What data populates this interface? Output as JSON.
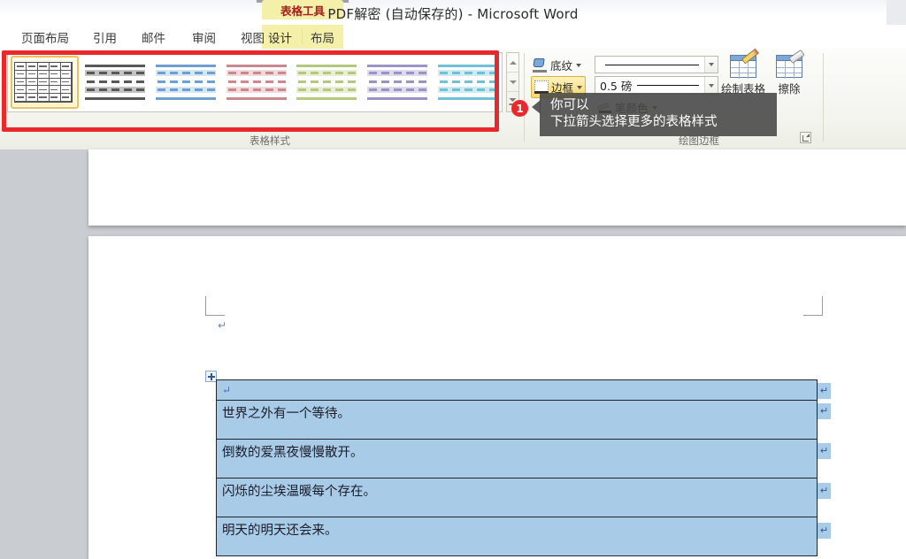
{
  "window": {
    "title": "PDF解密 (自动保存的)  -  Microsoft Word",
    "contextual_tab_group": "表格工具"
  },
  "ribbon": {
    "tabs": [
      {
        "label": "页面布局",
        "active": false
      },
      {
        "label": "引用",
        "active": false
      },
      {
        "label": "邮件",
        "active": false
      },
      {
        "label": "审阅",
        "active": false
      },
      {
        "label": "视图",
        "active": false
      },
      {
        "label": "设计",
        "active": true
      },
      {
        "label": "布局",
        "active": false
      }
    ],
    "groups": [
      {
        "label": "表格样式"
      },
      {
        "label": "绘图边框"
      }
    ],
    "table_styles": [
      {
        "name": "table-grid",
        "accent": "#4a4a4a",
        "selected": true,
        "kind": "grid"
      },
      {
        "name": "table-list-dark",
        "accent": "#58585a",
        "band": "#bdbdbd",
        "selected": false,
        "kind": "striped"
      },
      {
        "name": "table-list-blue",
        "accent": "#6f9fd0",
        "band": "#c6dcf0",
        "selected": false,
        "kind": "striped"
      },
      {
        "name": "table-list-red",
        "accent": "#c88a8d",
        "band": "#f0d3d5",
        "selected": false,
        "kind": "striped"
      },
      {
        "name": "table-list-green",
        "accent": "#b4c97e",
        "band": "#e2ebc8",
        "selected": false,
        "kind": "striped"
      },
      {
        "name": "table-list-purple",
        "accent": "#9a93c6",
        "band": "#d6d3ea",
        "selected": false,
        "kind": "striped"
      },
      {
        "name": "table-list-cyan",
        "accent": "#6fc0d8",
        "band": "#bfe4ee",
        "selected": false,
        "kind": "striped"
      }
    ],
    "gallery_scroll": {
      "up": "scroll-up",
      "down": "scroll-down",
      "more": "more-styles"
    },
    "shading_label": "底纹",
    "borders_label": "边框",
    "line_style_value": "",
    "line_weight_value": "0.5 磅",
    "pen_color_label": "笔颜色",
    "draw_table_label": "绘制表格",
    "eraser_label": "擦除"
  },
  "annotation": {
    "badge_number": "1",
    "callout_line1": "你可以",
    "callout_line2": "下拉箭头选择更多的表格样式",
    "highlight_color": "#e8282a"
  },
  "document": {
    "table_rows": [
      "",
      "世界之外有一个等待。",
      "倒数的爱黑夜慢慢散开。",
      "闪烁的尘埃温暖每个存在。",
      "明天的明天还会来。"
    ],
    "paragraph_mark": "↵",
    "cell_mark": "↵",
    "row_end_mark": "↵"
  }
}
